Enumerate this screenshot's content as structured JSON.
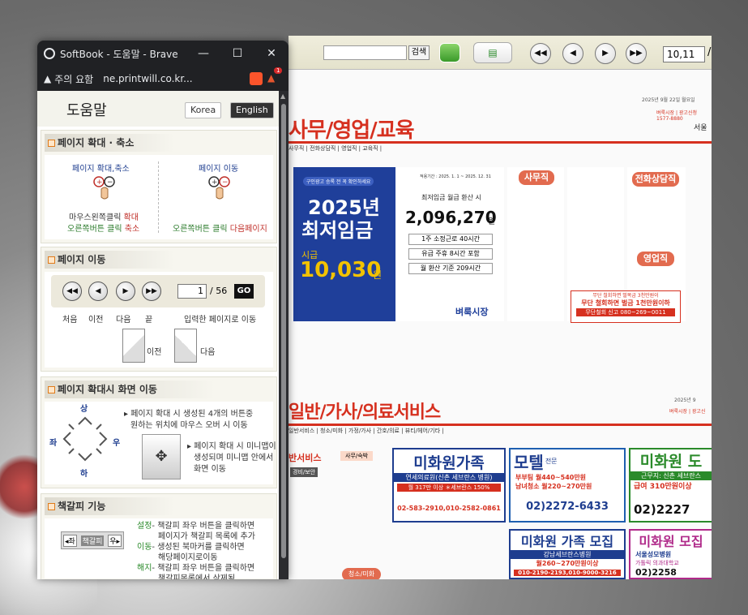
{
  "popup": {
    "tab_title": "SoftBook - 도움말 - Brave",
    "ctl_min": "—",
    "ctl_max": "☐",
    "ctl_close": "✕",
    "security": "주의 요함",
    "url": "ne.printwill.co.kr...",
    "shield_count": "1"
  },
  "help": {
    "title": "도움말",
    "lang_korea": "Korea",
    "lang_english": "English",
    "zoom": {
      "heading": "페이지 확대 · 축소",
      "left_title": "페이지 확대,축소",
      "left_l1a": "마우스왼쪽클릭",
      "left_l1b": "확대",
      "left_l2a": "오른쪽버튼 클릭",
      "left_l2b": "축소",
      "right_title": "페이지 이동",
      "right_l1a": "오른쪽버튼 클릭",
      "right_l1b": "다음페이지"
    },
    "move": {
      "heading": "페이지 이동",
      "page_value": "1",
      "total": "/ 56",
      "go": "GO",
      "lbl_first": "처음",
      "lbl_prev": "이전",
      "lbl_next": "다음",
      "lbl_last": "끝",
      "lbl_input": "입력한 페이지로 이동",
      "flip_prev": "이전",
      "flip_next": "다음"
    },
    "zoom_move": {
      "heading": "페이지 확대시 화면 이동",
      "dir_up": "상",
      "dir_left": "좌",
      "dir_right": "우",
      "dir_down": "하",
      "desc1a": "페이지 확대 시 생성된 4개의 버튼중",
      "desc1b": "원하는 위치에 마우스 오버 시 이동",
      "desc2a": "페이지 확대 시 미니맵이",
      "desc2b": "생성되며 미니맵 안에서",
      "desc2c": "화면 이동"
    },
    "bookmark": {
      "heading": "책갈피 기능",
      "widget_left": "◂좌",
      "widget_mid": "책갈피",
      "widget_right": "우▸",
      "set_k": "설정",
      "set_v1": "- 책갈피 좌우 버튼을 클릭하면",
      "set_v2": "페이지가 책갈피 목록에 추가",
      "move_k": "이동",
      "move_v1": "- 생성된 북마커를 클릭하면",
      "move_v2": "해당페이지로이동",
      "del_k": "해지",
      "del_v1": "- 책갈피 좌우 버튼을 클릭하면",
      "del_v2": "책갈피목록에서 삭제됨"
    }
  },
  "viewer": {
    "search_btn": "검색",
    "page_value": "10,11",
    "page_sep": "/",
    "section1": "사무/영업/교육",
    "section1_sub": "사무직 | 전화상담직 | 영업직 | 교육직 |",
    "top_right_date": "2025년 9월 22일 월요일",
    "top_right_sub": "벼룩시장 | 광고신청 1577-8880",
    "top_right_city": "서울",
    "wage_tag": "구인광고 승록 전 꼭 확인하세요",
    "wage_year": "2025년",
    "wage_title": "최저임금",
    "wage_hour_label": "시급",
    "wage_hour": "10,030",
    "wage_won": "원",
    "wage_period": "적용기간 : 2025. 1. 1 ~ 2025. 12. 31",
    "wage_month_label": "최저임금 월급 환산 시",
    "wage_month": "2,096,270",
    "wage_month_won": "원",
    "wage_row1": "1주 소정근로 40시간",
    "wage_row2": "유급 주휴 8시간 포함",
    "wage_row3": "월 환산 기준 209시간",
    "wage_brand": "벼룩시장",
    "badge_office": "사무직",
    "badge_call": "전화상담직",
    "badge_sales": "영업직",
    "report_title": "무단 철회하면 벌목금 3천만원이",
    "report_big": "무단 철회하면 벌금 1천만원이하",
    "report_tel": "무단철회 신고 080~269~0011",
    "section2": "일반/가사/의료서비스",
    "section2_sub": "일반서비스 | 청소/미화 | 가정/가사 | 간호/의료 | 뷰티/헤어/기타 |",
    "section2_date": "2025년 9",
    "section2_right": "벼룩시장 | 광고신",
    "ad1_head": "미화원가족",
    "ad1_sub": "연세의료원(신촌 세브란스 병원)",
    "ad1_pay": "월 317만 이상 ＊세브란스 150%",
    "ad1_tel": "02-583-2910,010-2582-0861",
    "ad2_head": "모텔",
    "ad2_side": "전문",
    "ad2_l1": "부부팀 월440~540만원",
    "ad2_l2": "남녀청소 월220~270만원",
    "ad2_tel": "02)2272-6433",
    "ad3_head": "미화원 도",
    "ad3_sub": "근무지: 신촌 세브란스",
    "ad3_l1": "급여 310만원이상",
    "ad3_tel": "02)2227",
    "ad4_head": "미화원 가족 모집",
    "ad4_sub": "강남세브란스병원",
    "ad4_pay": "월260~270만원이상",
    "ad4_tel": "010-2190-2193,010-9000-3216",
    "ad5_head": "미화원 모집",
    "ad5_sub": "서울성모병원",
    "ad5_l1": "가톨릭 의과대학교",
    "ad5_tel": "02)2258",
    "badge_clean": "청소/미화",
    "side_label1": "반서비스",
    "side_label2": "사무/숙박",
    "side_label3": "경비/보안"
  }
}
